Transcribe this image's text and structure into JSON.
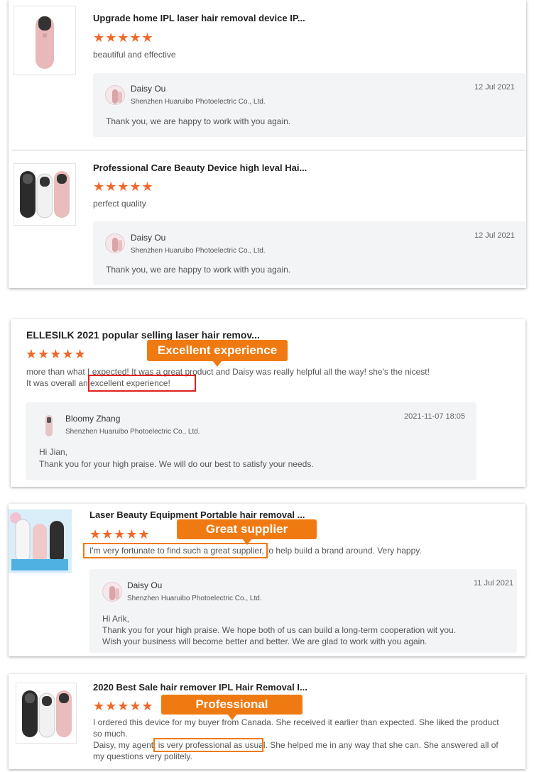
{
  "card1": {
    "reviews": [
      {
        "product_title": "Upgrade home IPL laser hair removal device IP...",
        "stars": "★★★★★",
        "review_text": "beautiful and effective",
        "reply": {
          "name": "Daisy Ou",
          "company": "Shenzhen Huaruibo Photoelectric Co., Ltd.",
          "date": "12 Jul 2021",
          "message": "Thank you, we are happy to work with you again."
        }
      },
      {
        "product_title": "Professional Care Beauty Device high leval Hai...",
        "stars": "★★★★★",
        "review_text": "perfect quality",
        "reply": {
          "name": "Daisy Ou",
          "company": "Shenzhen Huaruibo Photoelectric Co., Ltd.",
          "date": "12 Jul 2021",
          "message": "Thank you, we are happy to work with you again."
        }
      }
    ]
  },
  "card2": {
    "product_title": "ELLESILK 2021 popular selling laser hair remov...",
    "stars": "★★★★★",
    "callout": "Excellent experience",
    "review_line1": "more than what I expected! It was a great product and Daisy was really helpful all the way! she's the nicest!",
    "review_line2": "It was overall an excellent experience!",
    "reply": {
      "name": "Bloomy Zhang",
      "company": "Shenzhen Huaruibo Photoelectric Co., Ltd.",
      "date": "2021-11-07 18:05",
      "message_line1": "Hi Jian,",
      "message_line2": "Thank you for your high praise. We will do our best to satisfy your needs."
    }
  },
  "card3": {
    "product_title": "Laser Beauty Equipment Portable hair removal ...",
    "stars": "★★★★★",
    "callout": "Great supplier",
    "review_text": "I'm very fortunate to find such a great supplier, to help build a brand around. Very happy.",
    "reply": {
      "name": "Daisy Ou",
      "company": "Shenzhen Huaruibo Photoelectric Co., Ltd.",
      "date": "11 Jul 2021",
      "message_line1": "Hi Arik,",
      "message_line2": "Thank you for your high praise. We hope both of us can build a long-term cooperation wit you.",
      "message_line3": "Wish your business will become better and better. We are glad to work with you again."
    }
  },
  "card4": {
    "product_title": "2020 Best Sale hair remover IPL Hair Removal I...",
    "stars": "★★★★★",
    "callout": "Professional",
    "review_line1": "I ordered this device for my buyer from Canada. She received it earlier than expected. She liked the product",
    "review_line2": "so much.",
    "review_line3": "Daisy, my agent, is very professional as usual. She helped me in any way that she can. She answered all of",
    "review_line4": "my questions very politely."
  },
  "colors": {
    "accent": "#f07a12",
    "stars": "#f2682a",
    "highlight_red": "#e0201a"
  }
}
